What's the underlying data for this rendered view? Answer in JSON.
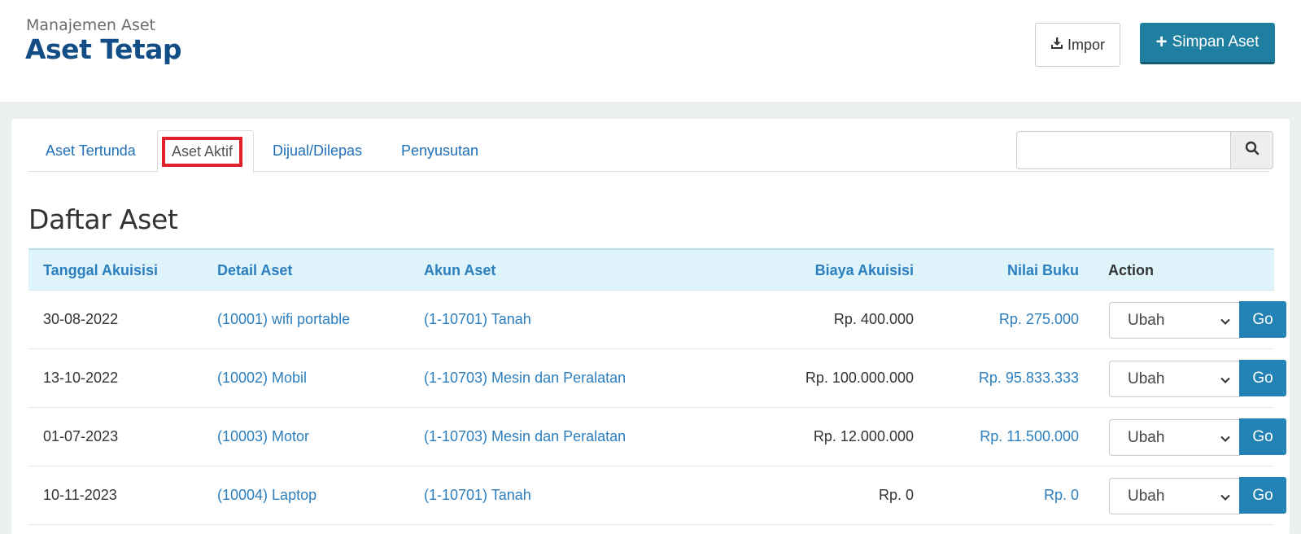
{
  "header": {
    "supertitle": "Manajemen Aset",
    "title": "Aset Tetap",
    "import_label": "Impor",
    "save_label": "Simpan Aset"
  },
  "tabs": [
    {
      "label": "Aset Tertunda",
      "active": false
    },
    {
      "label": "Aset Aktif",
      "active": true
    },
    {
      "label": "Dijual/Dilepas",
      "active": false
    },
    {
      "label": "Penyusutan",
      "active": false
    }
  ],
  "search": {
    "placeholder": "",
    "value": ""
  },
  "list": {
    "title": "Daftar Aset",
    "columns": {
      "date": "Tanggal Akuisisi",
      "detail": "Detail Aset",
      "account": "Akun Aset",
      "cost": "Biaya Akuisisi",
      "book": "Nilai Buku",
      "action": "Action"
    },
    "rows": [
      {
        "date": "30-08-2022",
        "detail": "(10001) wifi portable",
        "account": "(1-10701) Tanah",
        "cost": "Rp. 400.000",
        "book": "Rp. 275.000",
        "action": "Ubah",
        "go": "Go"
      },
      {
        "date": "13-10-2022",
        "detail": "(10002) Mobil",
        "account": "(1-10703) Mesin dan Peralatan",
        "cost": "Rp. 100.000.000",
        "book": "Rp. 95.833.333",
        "action": "Ubah",
        "go": "Go"
      },
      {
        "date": "01-07-2023",
        "detail": "(10003) Motor",
        "account": "(1-10703) Mesin dan Peralatan",
        "cost": "Rp. 12.000.000",
        "book": "Rp. 11.500.000",
        "action": "Ubah",
        "go": "Go"
      },
      {
        "date": "10-11-2023",
        "detail": "(10004) Laptop",
        "account": "(1-10701) Tanah",
        "cost": "Rp. 0",
        "book": "Rp. 0",
        "action": "Ubah",
        "go": "Go"
      }
    ]
  },
  "colors": {
    "title": "#124d85",
    "accent": "#1f7fa0",
    "link": "#2c7fbf",
    "highlight": "#e0202a",
    "header_row_bg": "#dff3fb"
  }
}
